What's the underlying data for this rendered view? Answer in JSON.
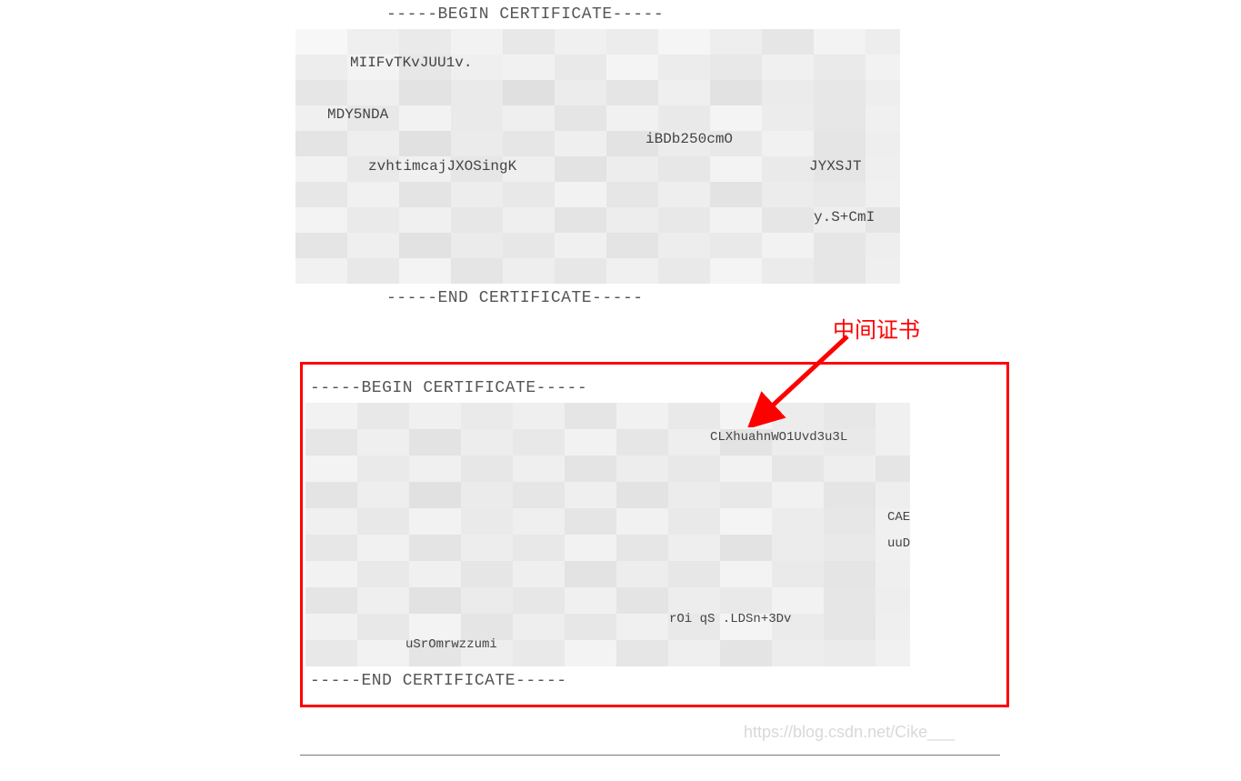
{
  "cert1": {
    "begin": "-----BEGIN CERTIFICATE-----",
    "end": "-----END CERTIFICATE-----",
    "peek_fragments": {
      "a": "MIIFvTKvJUU1v.",
      "b": "MDY5NDA",
      "c": "iBDb250cmO",
      "d": "zvhtimcajJXOSingK",
      "e": "JYXSJT",
      "f": "y.S+CmI"
    }
  },
  "cert2": {
    "begin": "-----BEGIN CERTIFICATE-----",
    "end": "-----END CERTIFICATE-----",
    "peek_fragments": {
      "g": "CLXhuahnWO1Uvd3u3L",
      "h": "CAE",
      "i": "uuD",
      "j": "rOi    qS   .LDSn+3Dv",
      "k": "uSrOmrwzzumi"
    }
  },
  "annotation": "中间证书",
  "watermark": "https://blog.csdn.net/Cike___"
}
